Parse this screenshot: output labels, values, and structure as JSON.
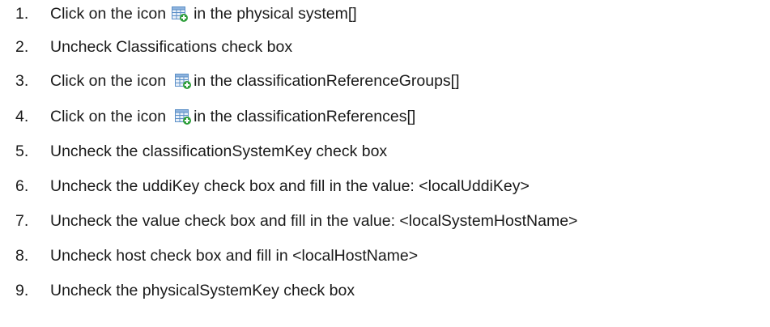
{
  "steps": [
    {
      "num": "1.",
      "before": "Click on the icon",
      "icon": "add-table-row-icon",
      "after": "in the physical system[]"
    },
    {
      "num": "2.",
      "text": "Uncheck Classifications check box"
    },
    {
      "num": "3.",
      "before": "Click on the icon",
      "icon": "add-table-row-icon",
      "after": "in the classificationReferenceGroups[]"
    },
    {
      "num": "4.",
      "before": "Click on the icon",
      "icon": "add-table-row-icon",
      "after": "in the classificationReferences[]"
    },
    {
      "num": "5.",
      "text": "Uncheck the classificationSystemKey check box"
    },
    {
      "num": "6.",
      "text": "Uncheck the uddiKey check box and fill in the value: <localUddiKey>"
    },
    {
      "num": "7.",
      "text": "Uncheck the value check box and fill in the value: <localSystemHostName>"
    },
    {
      "num": "8.",
      "text": "Uncheck host check box and fill in <localHostName>"
    },
    {
      "num": "9.",
      "text": "Uncheck the physicalSystemKey check box"
    }
  ],
  "colors": {
    "text": "#1a1a1a",
    "icon_grid": "#5b8fc7",
    "icon_fill": "#e8f0fa",
    "icon_plus": "#2e9e3a"
  }
}
